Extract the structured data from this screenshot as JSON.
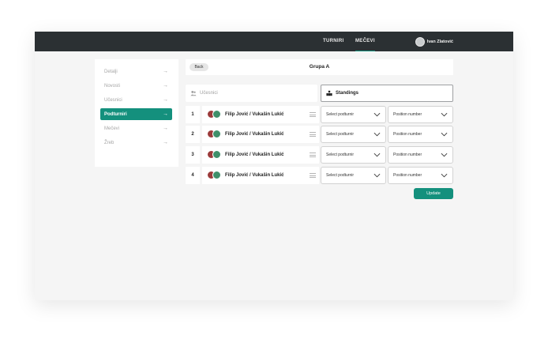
{
  "topbar": {
    "nav": [
      {
        "label": "TURNIRI",
        "active": false
      },
      {
        "label": "MEČEVI",
        "active": true
      }
    ],
    "user_name": "Ivan Zlatović"
  },
  "sidebar": {
    "items": [
      {
        "label": "Detalji",
        "active": false
      },
      {
        "label": "Novosti",
        "active": false
      },
      {
        "label": "Učesnici",
        "active": false
      },
      {
        "label": "Podturniri",
        "active": true
      },
      {
        "label": "Mečevi",
        "active": false
      },
      {
        "label": "Žreb",
        "active": false
      }
    ]
  },
  "header": {
    "back_label": "Back",
    "title": "Grupa A"
  },
  "tabs": {
    "participants_label": "Učesnici",
    "standings_label": "Standings"
  },
  "rows": [
    {
      "position": "1",
      "team": "Filip Jović / Vukašin Lukić",
      "subtournament_placeholder": "Select podturnir",
      "position_placeholder": "Position number"
    },
    {
      "position": "2",
      "team": "Filip Jović / Vukašin Lukić",
      "subtournament_placeholder": "Select podturnir",
      "position_placeholder": "Position number"
    },
    {
      "position": "3",
      "team": "Filip Jović / Vukašin Lukić",
      "subtournament_placeholder": "Select podturnir",
      "position_placeholder": "Position number"
    },
    {
      "position": "4",
      "team": "Filip Jović / Vukašin Lukić",
      "subtournament_placeholder": "Select podturnir",
      "position_placeholder": "Position number"
    }
  ],
  "update_label": "Update",
  "colors": {
    "accent": "#14907d",
    "topbar": "#2b3033",
    "background": "#f5f5f5"
  }
}
